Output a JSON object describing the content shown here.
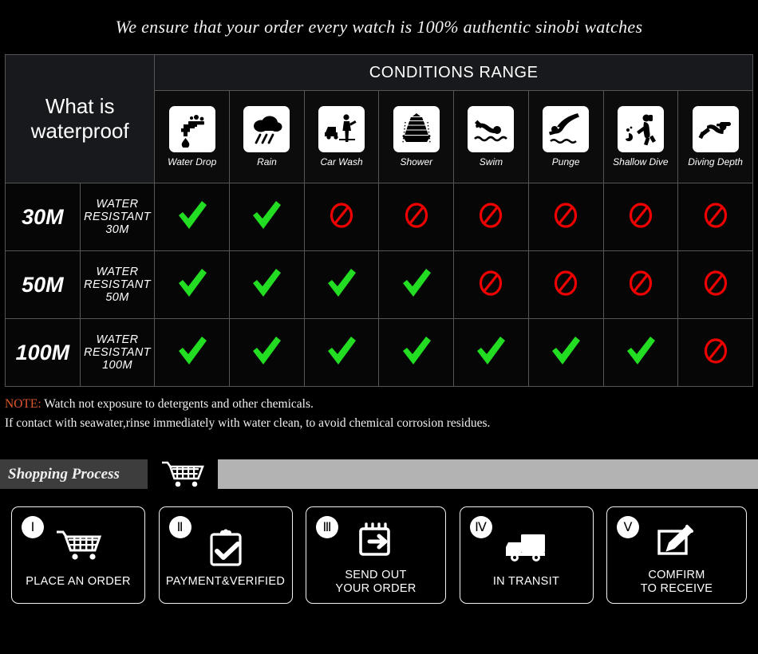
{
  "header": {
    "tagline": "We ensure that your order every watch is 100% authentic sinobi watches"
  },
  "table": {
    "left_header": "What is waterproof",
    "conditions_title": "CONDITIONS RANGE",
    "conditions": [
      {
        "label": "Water Drop",
        "icon": "faucet-drop-icon"
      },
      {
        "label": "Rain",
        "icon": "rain-cloud-icon"
      },
      {
        "label": "Car Wash",
        "icon": "car-wash-icon"
      },
      {
        "label": "Shower",
        "icon": "shower-icon"
      },
      {
        "label": "Swim",
        "icon": "swim-icon"
      },
      {
        "label": "Punge",
        "icon": "plunge-dive-icon"
      },
      {
        "label": "Shallow Dive",
        "icon": "shallow-dive-icon"
      },
      {
        "label": "Diving Depth",
        "icon": "scuba-diving-icon"
      }
    ],
    "rows": [
      {
        "depth": "30M",
        "description": "WATER RESISTANT  30M",
        "marks": [
          "yes",
          "yes",
          "no",
          "no",
          "no",
          "no",
          "no",
          "no"
        ]
      },
      {
        "depth": "50M",
        "description": "WATER RESISTANT 50M",
        "marks": [
          "yes",
          "yes",
          "yes",
          "yes",
          "no",
          "no",
          "no",
          "no"
        ]
      },
      {
        "depth": "100M",
        "description": "WATER RESISTANT  100M",
        "marks": [
          "yes",
          "yes",
          "yes",
          "yes",
          "yes",
          "yes",
          "yes",
          "no"
        ]
      }
    ]
  },
  "note": {
    "keyword": "NOTE:",
    "line1": " Watch not exposure to detergents and other chemicals.",
    "line2": "If contact with seawater,rinse immediately with water clean, to avoid chemical corrosion residues."
  },
  "shopping_process": {
    "label": "Shopping Process",
    "cart_icon": "shopping-cart-icon",
    "steps": [
      {
        "numeral": "Ⅰ",
        "label": "PLACE AN ORDER",
        "icon": "shopping-cart-icon"
      },
      {
        "numeral": "Ⅱ",
        "label": "PAYMENT&VERIFIED",
        "icon": "clipboard-check-icon"
      },
      {
        "numeral": "Ⅲ",
        "label": "SEND OUT\nYOUR ORDER",
        "icon": "calendar-arrow-icon"
      },
      {
        "numeral": "Ⅳ",
        "label": "IN TRANSIT",
        "icon": "delivery-truck-icon"
      },
      {
        "numeral": "Ⅴ",
        "label": "COMFIRM\nTO RECEIVE",
        "icon": "sign-receipt-icon"
      }
    ]
  },
  "colors": {
    "background": "#000000",
    "check_green": "#22dd22",
    "prohibit_red": "#ee0000",
    "note_keyword": "#e2572a",
    "header_cell": "#17191d",
    "bar_dark": "#3d3d3d",
    "bar_light": "#b3b3b3",
    "grid_line": "#555555"
  }
}
